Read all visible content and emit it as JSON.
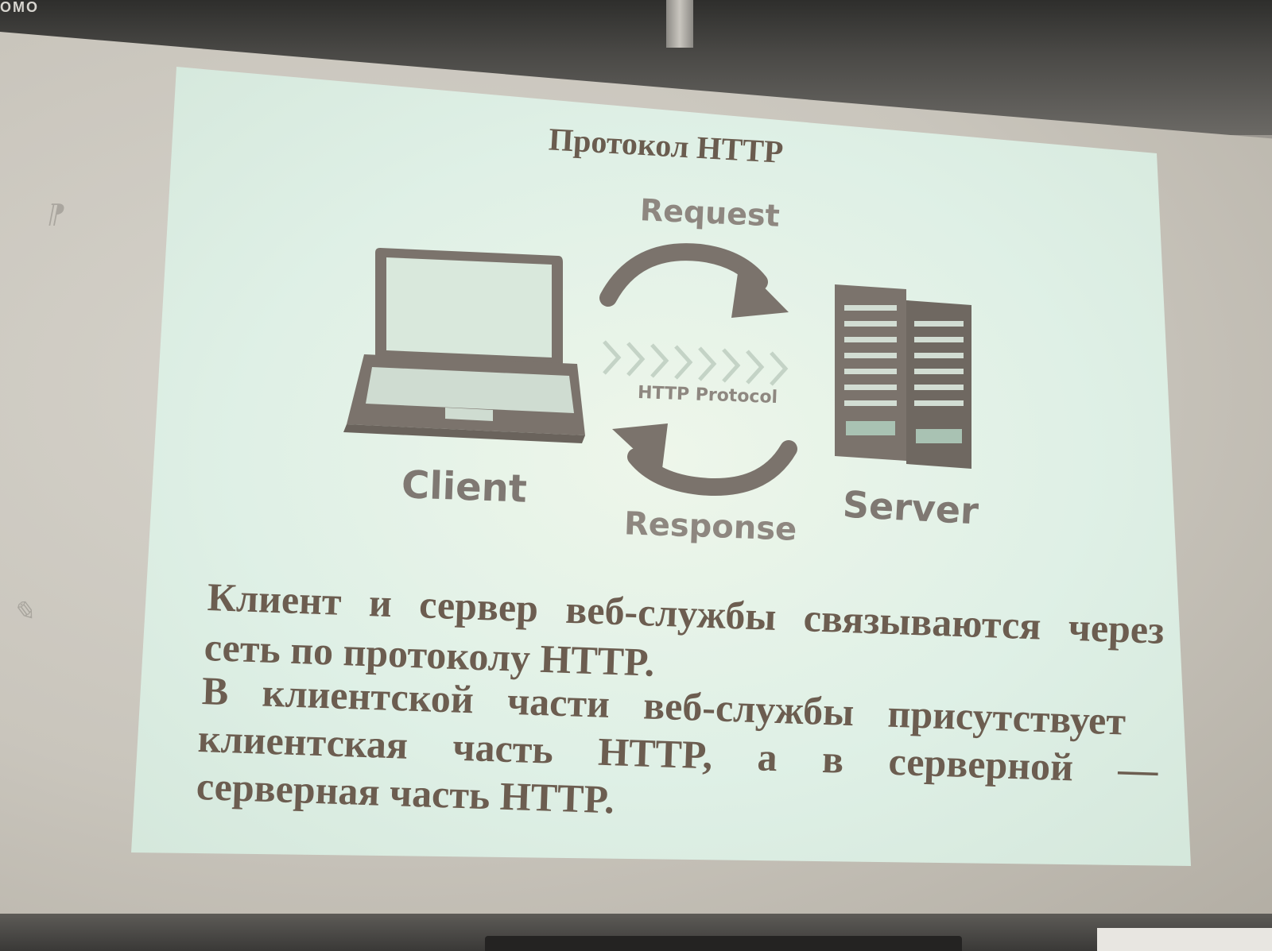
{
  "brand": {
    "logo_text": "OMO"
  },
  "slide": {
    "title": "Протокол HTTP",
    "diagram": {
      "request_label": "Request",
      "protocol_label": "HTTP Protocol",
      "response_label": "Response",
      "client_label": "Client",
      "server_label": "Server"
    },
    "paragraph1": {
      "line1": "Клиент и сервер веб-службы связываются через",
      "line2": "сеть по протоколу HTTP."
    },
    "paragraph2": {
      "line1": "В клиентской части веб-службы присутствует",
      "line2": "клиентская часть HTTP, а в серверной —",
      "line3": "серверная часть HTTP."
    }
  },
  "colors": {
    "slide_background": "#dff0e6",
    "text": "#6c5d50",
    "icon": "#7b736c"
  }
}
